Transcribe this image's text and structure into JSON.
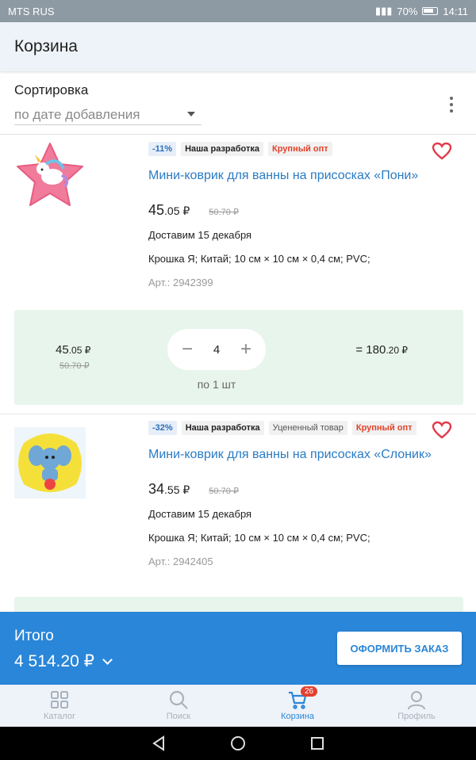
{
  "status_bar": {
    "carrier": "MTS RUS",
    "battery": "70%",
    "time": "14:11"
  },
  "header": {
    "title": "Корзина"
  },
  "sort": {
    "label": "Сортировка",
    "selected": "по дате добавления"
  },
  "products": [
    {
      "tags": [
        {
          "text": "-11%",
          "kind": "discount"
        },
        {
          "text": "Наша разработка",
          "kind": "default"
        },
        {
          "text": "Крупный опт",
          "kind": "bulk"
        }
      ],
      "name": "Мини-коврик для ванны на присосках «Пони»",
      "price_int": "45",
      "price_dec": ".05 ₽",
      "old_price": "50.70 ₽",
      "delivery": "Доставим 15 декабря",
      "specs": "Крошка Я; Китай; 10 см × 10 см × 0,4 см; PVC;",
      "article": "Арт.: 2942399",
      "qty": {
        "unit_int": "45",
        "unit_dec": ".05 ₽",
        "unit_old": "50.70 ₽",
        "value": "4",
        "per": "по 1 шт",
        "total_prefix": "= 180",
        "total_dec": ".20 ₽"
      }
    },
    {
      "tags": [
        {
          "text": "-32%",
          "kind": "discount"
        },
        {
          "text": "Наша разработка",
          "kind": "default"
        },
        {
          "text": "Уцененный товар",
          "kind": "grey"
        },
        {
          "text": "Крупный опт",
          "kind": "bulk"
        }
      ],
      "name": "Мини-коврик для ванны на присосках «Слоник»",
      "price_int": "34",
      "price_dec": ".55 ₽",
      "old_price": "50.70 ₽",
      "delivery": "Доставим 15 декабря",
      "specs": "Крошка Я; Китай; 10 см × 10 см × 0,4 см; PVC;",
      "article": "Арт.: 2942405"
    }
  ],
  "total": {
    "label": "Итого",
    "sum": "4 514.20 ₽",
    "order_button": "ОФОРМИТЬ ЗАКАЗ"
  },
  "tabs": [
    {
      "label": "Каталог",
      "icon": "grid-icon"
    },
    {
      "label": "Поиск",
      "icon": "search-icon"
    },
    {
      "label": "Корзина",
      "icon": "cart-icon",
      "badge": "26",
      "active": true
    },
    {
      "label": "Профиль",
      "icon": "profile-icon"
    }
  ],
  "colors": {
    "accent": "#2a86d8",
    "link": "#2a7bc4",
    "sale_red": "#e3412a",
    "qty_bg": "#e8f5ec"
  }
}
